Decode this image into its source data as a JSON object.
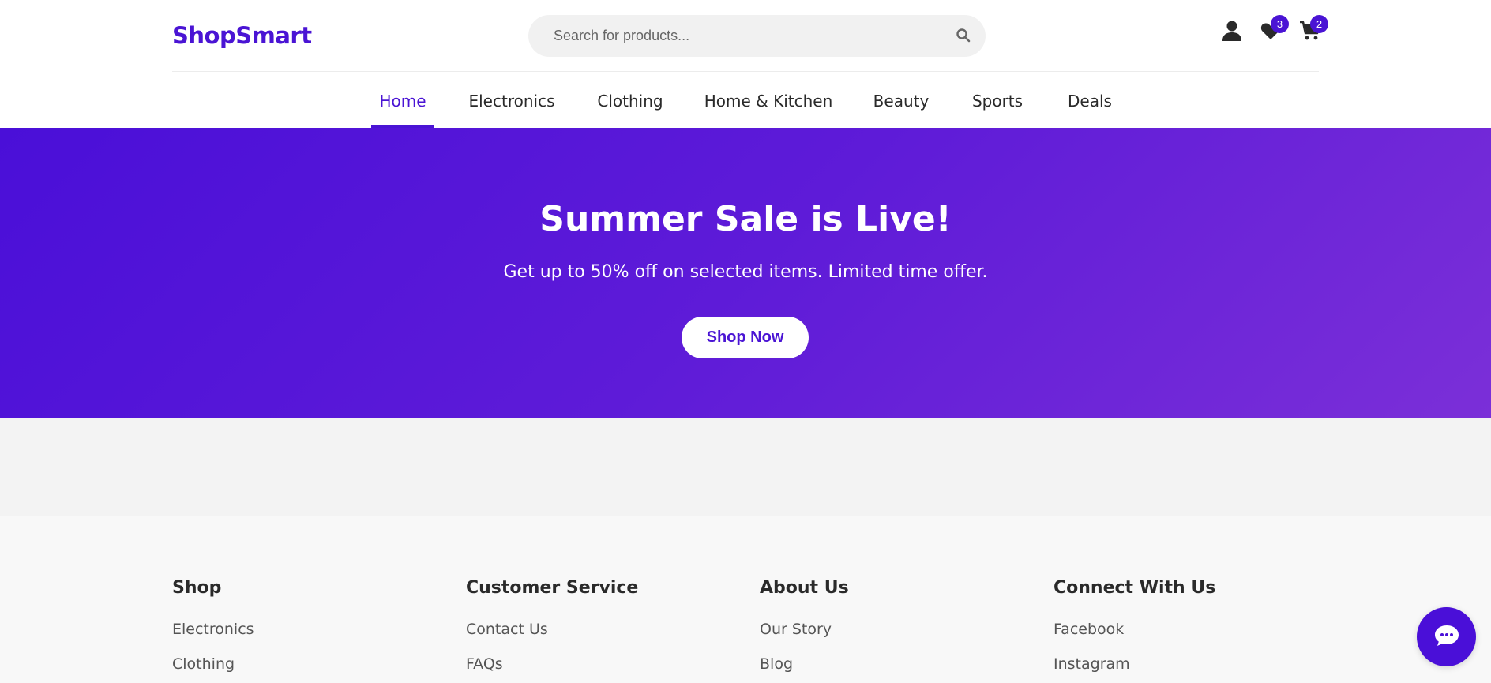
{
  "header": {
    "logo": "ShopSmart",
    "search": {
      "placeholder": "Search for products...",
      "value": ""
    },
    "wishlist_count": "3",
    "cart_count": "2"
  },
  "nav": {
    "items": [
      {
        "label": "Home",
        "active": true
      },
      {
        "label": "Electronics"
      },
      {
        "label": "Clothing"
      },
      {
        "label": "Home & Kitchen"
      },
      {
        "label": "Beauty"
      },
      {
        "label": "Sports"
      },
      {
        "label": "Deals"
      }
    ]
  },
  "hero": {
    "title": "Summer Sale is Live!",
    "subtitle": "Get up to 50% off on selected items. Limited time offer.",
    "button": "Shop Now"
  },
  "footer": {
    "columns": [
      {
        "heading": "Shop",
        "links": [
          "Electronics",
          "Clothing"
        ]
      },
      {
        "heading": "Customer Service",
        "links": [
          "Contact Us",
          "FAQs"
        ]
      },
      {
        "heading": "About Us",
        "links": [
          "Our Story",
          "Blog"
        ]
      },
      {
        "heading": "Connect With Us",
        "links": [
          "Facebook",
          "Instagram"
        ]
      }
    ]
  },
  "colors": {
    "brand": "#4a14d4",
    "hero_start": "#4a0fd8",
    "hero_end": "#7b2fd8"
  },
  "icons": [
    "search-icon",
    "user-icon",
    "heart-icon",
    "cart-icon",
    "chat-icon"
  ]
}
